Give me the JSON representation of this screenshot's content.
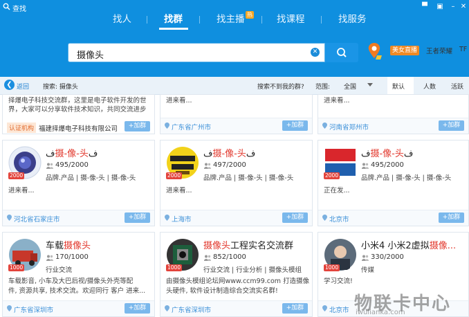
{
  "window": {
    "title": "查找"
  },
  "nav": {
    "tabs": [
      {
        "label": "找人"
      },
      {
        "label": "找群"
      },
      {
        "label": "找主播",
        "badge": "热"
      },
      {
        "label": "找课程"
      },
      {
        "label": "找服务"
      }
    ]
  },
  "search": {
    "value": "摄像头"
  },
  "header_right": {
    "live_badge": "美女直播",
    "glory": "王者荣耀",
    "tf": "TF"
  },
  "filter": {
    "back": "返回",
    "query": "搜索: 摄像头",
    "not_found": "搜索不到我的群?",
    "range_label": "范围:",
    "range_value": "全国",
    "sort_default": "默认",
    "sort_members": "人数",
    "sort_active": "活跃"
  },
  "join_label": "+加群",
  "cards_top": [
    {
      "desc": "择爆电子科技交流群，这里是电子软件开发的世",
      "desc2": "界，大家可以分享软件技术知识，共同交流进步",
      "cert": "认证机构",
      "org": "福建择爆电子科技有限公司",
      "location": ""
    },
    {
      "desc": "进来看...",
      "location": "广东省广州市"
    },
    {
      "desc": "进来看...",
      "location": "河南省郑州市"
    }
  ],
  "cards_mid": [
    {
      "name_pre": "ف",
      "name_red": "摄-像-头",
      "name_post": "ف",
      "level": "2000",
      "members": "495/2000",
      "tags": "品牌.产品 | 摄-像-头 | 摄-像-头",
      "desc": "进来看...",
      "location": "河北省石家庄市"
    },
    {
      "name_pre": "ف",
      "name_red": "摄-像-头",
      "name_post": "ف",
      "level": "2000",
      "members": "497/2000",
      "tags": "品牌.产品 | 摄-像-头 | 摄-像-头",
      "desc": "进来看...",
      "location": "上海市"
    },
    {
      "name_pre": "ف",
      "name_red": "摄-像-头",
      "name_post": "ف",
      "level": "2000",
      "members": "495/2000",
      "tags": "品牌.产品 | 摄-像-头 | 摄-像-头",
      "desc": "正在发...",
      "location": "北京市"
    }
  ],
  "cards_bottom": [
    {
      "name_pre": "车载",
      "name_red": "摄像头",
      "name_post": "",
      "level": "1000",
      "members": "170/1000",
      "tags": "行业交流",
      "desc": "车载影音, 小车及大巴后视/摄像头外壳等配",
      "desc2": "件, 资源共享, 技术交流。欢迎同行 客户 进来...",
      "location": "广东省深圳市"
    },
    {
      "name_pre": "",
      "name_red": "摄像头",
      "name_post": "工程实名交流群",
      "level": "1000",
      "members": "852/1000",
      "tags": "行业交流 | 行业分析 | 摄像头模组",
      "desc": "由摄像头模组论坛网www.ccm99.com 打造摄像",
      "desc2": "头硬件, 软件设计制造综合交流实名群!",
      "location": "广东省深圳市"
    },
    {
      "name_pre": "小米4 小米2虚拟",
      "name_red": "摄像...",
      "name_post": "",
      "level": "1000",
      "members": "330/2000",
      "tags": "传媒",
      "desc": "学习交流!",
      "location": "北京市"
    }
  ],
  "watermark": {
    "main": "物联卡中心",
    "sub": "iwulianka.com"
  }
}
